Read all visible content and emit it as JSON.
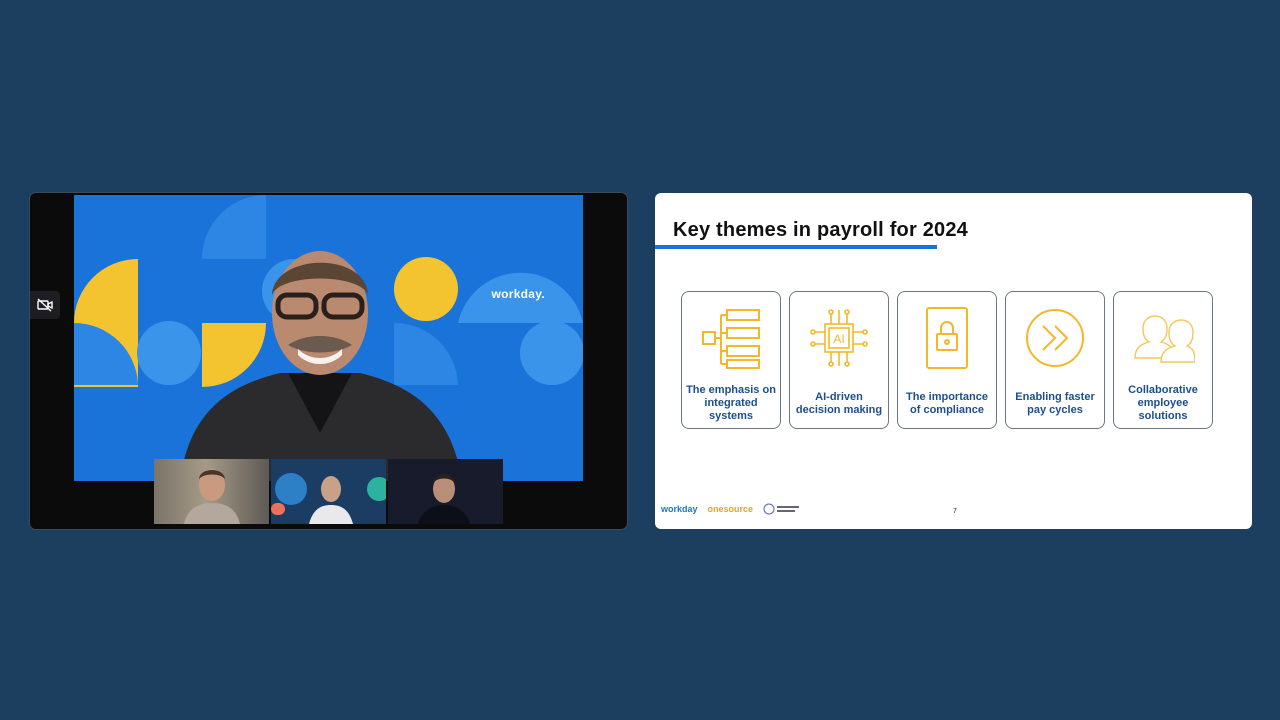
{
  "video": {
    "main_logo": "workday.",
    "camera_icon": "video-off-icon",
    "thumbnails": [
      {
        "label": ""
      },
      {
        "label": ""
      },
      {
        "label": ""
      }
    ]
  },
  "slide": {
    "title": "Key themes in payroll for 2024",
    "cards": [
      {
        "icon": "flowchart-icon",
        "label": "The emphasis on integrated systems"
      },
      {
        "icon": "ai-chip-icon",
        "label": "AI-driven decision making"
      },
      {
        "icon": "lock-icon",
        "label": "The importance of compliance"
      },
      {
        "icon": "fast-forward-icon",
        "label": "Enabling faster pay cycles"
      },
      {
        "icon": "people-icon",
        "label": "Collaborative employee solutions"
      }
    ],
    "footer": {
      "workday_logo": "workday",
      "onesource_logo": "onesource",
      "page_number": "7"
    }
  },
  "colors": {
    "background": "#1c3f60",
    "accent_blue": "#1a73d9",
    "icon_gold": "#f2b829",
    "label_blue": "#1d4f8c"
  }
}
